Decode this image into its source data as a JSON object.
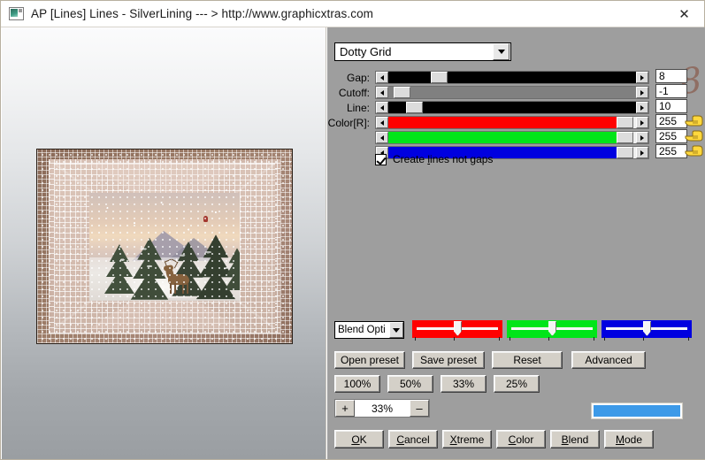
{
  "window": {
    "title": "AP [Lines]  Lines - SilverLining    --- > http://www.graphicxtras.com",
    "icon": "application-icon",
    "close_label": "✕"
  },
  "preview": {
    "artwork_alt": "winter-scene-deer-pine-trees-with-dotty-grid-frame"
  },
  "panel": {
    "preset": {
      "selected": "Dotty Grid"
    },
    "sliders": [
      {
        "label": "Gap:",
        "value": "8",
        "fill": "#000000",
        "thumb_pct": 17,
        "fill_pct": 17
      },
      {
        "label": "Cutoff:",
        "value": "-1",
        "fill": "#808080",
        "thumb_pct": 2,
        "fill_pct": 2
      },
      {
        "label": "Line:",
        "value": "10",
        "fill": "#000000",
        "thumb_pct": 7,
        "fill_pct": 7
      },
      {
        "label": "Color[R]:",
        "value": "255",
        "fill": "#ff0000",
        "thumb_pct": 92,
        "fill_pct": 92
      },
      {
        "label": "",
        "value": "255",
        "fill": "#00e519",
        "thumb_pct": 92,
        "fill_pct": 92
      },
      {
        "label": "",
        "value": "255",
        "fill": "#0000e0",
        "thumb_pct": 92,
        "fill_pct": 92
      }
    ],
    "checkbox": {
      "checked": true,
      "label_before": "Create ",
      "label_accel": "l",
      "label_after": "ines not gaps"
    },
    "blend_combo": {
      "value": "Blend Opti"
    },
    "rgb_trackbars": [
      {
        "name": "red-trackbar",
        "color": "#ff0000",
        "thumb_pct": 46
      },
      {
        "name": "green-trackbar",
        "color": "#00e519",
        "thumb_pct": 46
      },
      {
        "name": "blue-trackbar",
        "color": "#0000e0",
        "thumb_pct": 46
      }
    ],
    "preset_buttons": [
      {
        "label": "Open preset"
      },
      {
        "label": "Save preset"
      },
      {
        "label": "Reset"
      },
      {
        "label": "Advanced"
      }
    ],
    "zoom_buttons": [
      {
        "label": "100%"
      },
      {
        "label": "50%"
      },
      {
        "label": "33%"
      },
      {
        "label": "25%"
      }
    ],
    "zoom_stepper": {
      "plus": "+",
      "value": "33%",
      "minus": "–"
    },
    "color_swatch": {
      "color": "#3d9ae8"
    },
    "action_buttons": [
      {
        "accel": "O",
        "rest": "K"
      },
      {
        "accel": "C",
        "rest": "ancel",
        "pre": ""
      },
      {
        "accel": "X",
        "rest": "treme"
      },
      {
        "accel": "C",
        "rest": "olor"
      },
      {
        "accel": "B",
        "rest": "lend"
      },
      {
        "accel": "M",
        "rest": "ode"
      }
    ],
    "decor_swash": "8"
  }
}
